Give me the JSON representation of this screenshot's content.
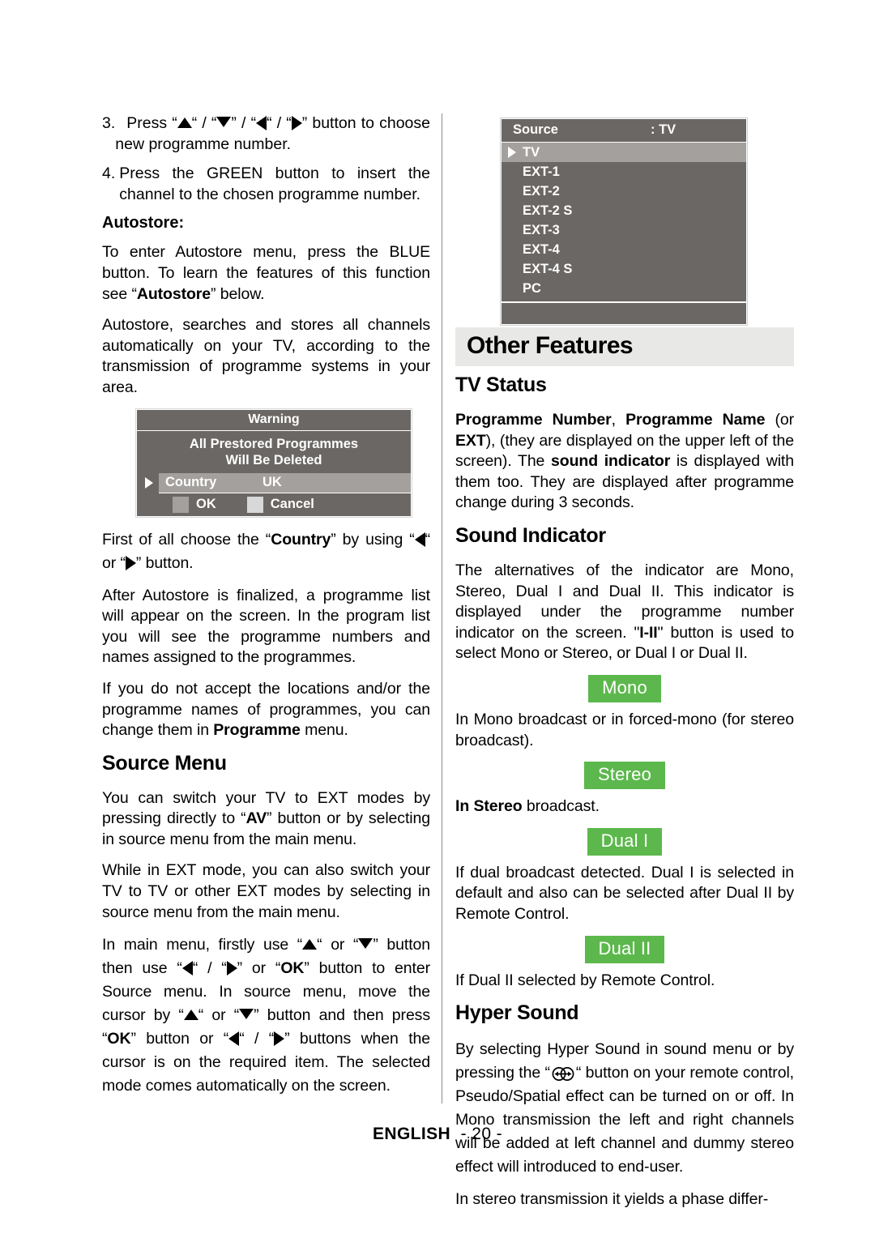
{
  "page": {
    "footer_language": "ENGLISH",
    "footer_page": "- 20 -"
  },
  "colors": {
    "osd_background": "#6b6764",
    "osd_highlight": "#a3a09d",
    "badge_green": "#5cb84c",
    "banner_gray": "#e8e8e6"
  },
  "left_column": {
    "step3": {
      "number": "3.",
      "text_a": "Press “",
      "text_b": "“ / “",
      "text_c": "” / “",
      "text_d": "“ / “",
      "text_e": "” button to choose new programme number."
    },
    "step4": {
      "number": "4.",
      "text": "Press the GREEN button to insert the channel to the chosen programme number."
    },
    "autostore_heading": "Autostore:",
    "para_enter_autostore_1": "To enter Autostore menu, press the BLUE button. To learn the features of this function see “",
    "para_enter_autostore_bold": "Autostore",
    "para_enter_autostore_2": "” below.",
    "para_autostore_desc": "Autostore, searches and stores all channels automatically on your TV, according to the transmission of programme systems in your area.",
    "warning_dialog": {
      "title": "Warning",
      "message_line1": "All Prestored  Programmes",
      "message_line2": "Will Be Deleted",
      "row_key": "Country",
      "row_value": "UK",
      "button_ok": "OK",
      "button_cancel": "Cancel"
    },
    "para_choose_country_1": "First of all choose the “",
    "para_choose_country_bold": "Country",
    "para_choose_country_2": "” by using “",
    "para_choose_country_3": "“ or “",
    "para_choose_country_4": "” button.",
    "para_after_autostore": "After Autostore is finalized, a programme list will appear on the screen. In the program list you will see the programme numbers and names assigned to the programmes.",
    "para_not_accept_1": "If you do not accept the locations and/or the programme names of programmes, you can change them in ",
    "para_not_accept_bold": "Programme",
    "para_not_accept_2": " menu.",
    "source_menu_heading": "Source Menu",
    "para_switch_ext_1": "You can switch your TV to EXT modes by pressing directly to “",
    "para_switch_ext_bold": "AV",
    "para_switch_ext_2": "” button or by selecting in source menu from the main menu.",
    "para_while_ext": "While in EXT mode, you can also switch your TV to TV or other EXT modes by selecting in source menu from the main menu.",
    "para_main_menu": {
      "t1": "In main menu, firstly use “",
      "t2": "“ or “",
      "t3": "” button then use “",
      "t4": "“ / “",
      "t5": "” or “",
      "ok1": "OK",
      "t6": "” button to enter Source menu. In source menu, move the cursor by “",
      "t7": "“ or “",
      "t8": "” button and then press “",
      "ok2": "OK",
      "t9": "” button or “",
      "t10": "“ / “",
      "t11": "” buttons when the cursor is on the required item. The selected mode comes automatically on the screen."
    }
  },
  "right_column": {
    "source_osd": {
      "header_label": "Source",
      "header_value": ": TV",
      "items": [
        {
          "label": "TV",
          "selected": true
        },
        {
          "label": "EXT-1",
          "selected": false
        },
        {
          "label": "EXT-2",
          "selected": false
        },
        {
          "label": "EXT-2 S",
          "selected": false
        },
        {
          "label": "EXT-3",
          "selected": false
        },
        {
          "label": "EXT-4",
          "selected": false
        },
        {
          "label": "EXT-4 S",
          "selected": false
        },
        {
          "label": "PC",
          "selected": false
        }
      ]
    },
    "banner_title": "Other Features",
    "tv_status_heading": "TV Status",
    "tv_status_para": {
      "b1": "Programme Number",
      "t1": ", ",
      "b2": "Programme Name",
      "t2": " (or ",
      "b3": "EXT",
      "t3": "), (they are displayed on the upper left of the screen). The ",
      "b4": "sound indicator",
      "t4": " is displayed with them too. They are displayed after programme change during 3 seconds."
    },
    "sound_indicator_heading": "Sound Indicator",
    "sound_indicator_para": {
      "t1": "The alternatives of the indicator are Mono, Stereo, Dual I and Dual II. This indicator is displayed under the programme number indicator on the screen. \"",
      "b1": "I-II",
      "t2": "\" button is used to select Mono or Stereo, or Dual I or Dual II."
    },
    "badge_mono": "Mono",
    "para_mono": "In Mono broadcast or in forced-mono (for stereo broadcast).",
    "badge_stereo": "Stereo",
    "para_stereo_bold": "In Stereo",
    "para_stereo_rest": " broadcast.",
    "badge_dual_i": "Dual I",
    "para_dual_i": "If dual broadcast detected. Dual I is selected in default and also can be selected after Dual II by Remote Control.",
    "badge_dual_ii": "Dual II",
    "para_dual_ii": "If Dual II selected by Remote Control.",
    "hyper_sound_heading": "Hyper Sound",
    "hyper_sound_para": {
      "t1": "By selecting Hyper Sound in sound menu or by pressing the “",
      "t2": "“ button on your remote control, Pseudo/Spatial effect can be turned on or off. In Mono transmission the left and right channels will be added at left channel and dummy stereo effect will introduced to end-user."
    },
    "para_stereo_transmission": "In stereo transmission it yields a phase differ-"
  }
}
